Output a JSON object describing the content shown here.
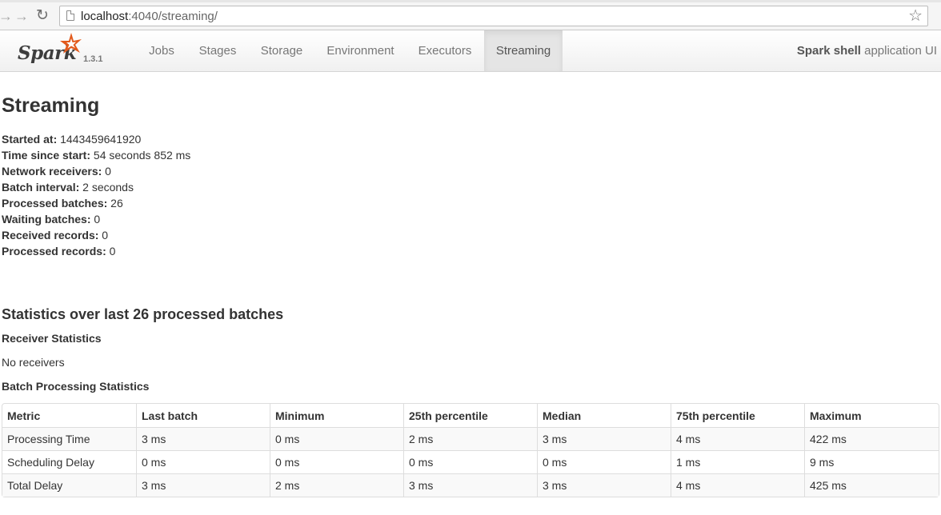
{
  "browser": {
    "url_host": "localhost",
    "url_path": ":4040/streaming/"
  },
  "navbar": {
    "brand": "Spark",
    "version": "1.3.1",
    "tabs": [
      {
        "label": "Jobs"
      },
      {
        "label": "Stages"
      },
      {
        "label": "Storage"
      },
      {
        "label": "Environment"
      },
      {
        "label": "Executors"
      },
      {
        "label": "Streaming",
        "active": true
      }
    ],
    "app_name": "Spark shell",
    "app_suffix": " application UI"
  },
  "page": {
    "title": "Streaming",
    "stats": [
      {
        "label": "Started at:",
        "value": " 1443459641920"
      },
      {
        "label": "Time since start:",
        "value": " 54 seconds 852 ms"
      },
      {
        "label": "Network receivers:",
        "value": " 0"
      },
      {
        "label": "Batch interval:",
        "value": " 2 seconds"
      },
      {
        "label": "Processed batches:",
        "value": " 26"
      },
      {
        "label": "Waiting batches:",
        "value": " 0"
      },
      {
        "label": "Received records:",
        "value": " 0"
      },
      {
        "label": "Processed records:",
        "value": " 0"
      }
    ],
    "section_title": "Statistics over last 26 processed batches",
    "receiver_title": "Receiver Statistics",
    "no_receivers": "No receivers",
    "batch_title": "Batch Processing Statistics"
  },
  "batch_table": {
    "headers": [
      "Metric",
      "Last batch",
      "Minimum",
      "25th percentile",
      "Median",
      "75th percentile",
      "Maximum"
    ],
    "rows": [
      [
        "Processing Time",
        "3 ms",
        "0 ms",
        "2 ms",
        "3 ms",
        "4 ms",
        "422 ms"
      ],
      [
        "Scheduling Delay",
        "0 ms",
        "0 ms",
        "0 ms",
        "0 ms",
        "1 ms",
        "9 ms"
      ],
      [
        "Total Delay",
        "3 ms",
        "2 ms",
        "3 ms",
        "3 ms",
        "4 ms",
        "425 ms"
      ]
    ]
  },
  "colors": {
    "accent_orange": "#e25a1c",
    "active_tab_bg": "#e5e5e5",
    "table_stripe": "#f9f9f9"
  },
  "icons": {
    "back": "back-arrow-icon",
    "forward": "forward-arrow-icon",
    "reload": "reload-icon",
    "page": "page-icon",
    "bookmark": "star-icon",
    "logo_star": "spark-star-icon"
  }
}
